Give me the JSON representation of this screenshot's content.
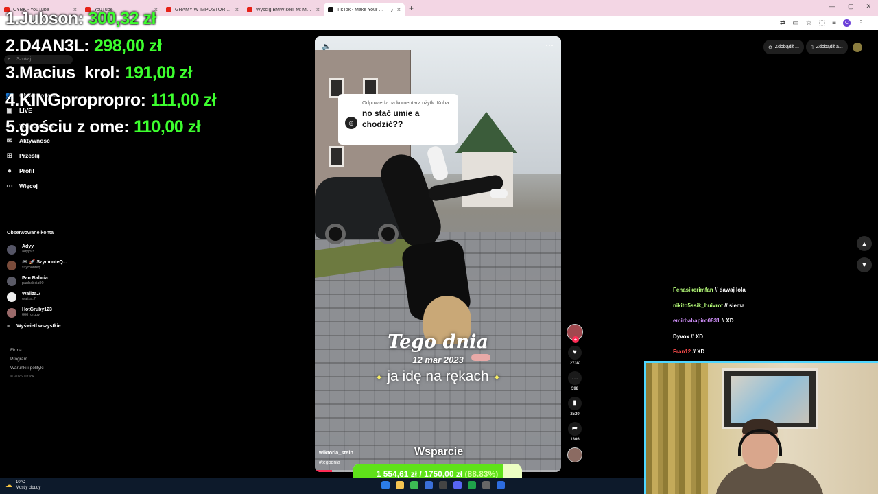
{
  "browser": {
    "tabs": [
      {
        "label": "CYBK - YouTube",
        "active": false
      },
      {
        "label": "YouTube",
        "active": false
      },
      {
        "label": "GRAMY W IMPOSTORA *INTEL",
        "active": false
      },
      {
        "label": "Wyścig BMW serii M: M2, M3, M",
        "active": false
      },
      {
        "label": "TikTok - Make Your Day",
        "active": true
      }
    ],
    "profile_initial": "C"
  },
  "leaderboard": [
    {
      "rank": "1.",
      "name": "Jubson:",
      "amount": "300,32 zł"
    },
    {
      "rank": "2.",
      "name": "D4AN3L:",
      "amount": "298,00 zł"
    },
    {
      "rank": "3.",
      "name": "Macius_krol:",
      "amount": "191,00 zł"
    },
    {
      "rank": "4.",
      "name": "KINGpropropro:",
      "amount": "111,00 zł"
    },
    {
      "rank": "5.",
      "name": "gościu z ome:",
      "amount": "110,00 zł"
    }
  ],
  "sidebar": {
    "search_placeholder": "Szukaj",
    "nav": [
      {
        "label": "Obserwowani",
        "icon": "people-icon"
      },
      {
        "label": "LIVE",
        "icon": "live-icon"
      },
      {
        "label": "Wiadomości",
        "icon": "messages-icon"
      },
      {
        "label": "Aktywność",
        "icon": "activity-icon"
      },
      {
        "label": "Prześlij",
        "icon": "upload-icon"
      },
      {
        "label": "Profil",
        "icon": "profile-icon"
      },
      {
        "label": "Więcej",
        "icon": "more-icon"
      }
    ],
    "following_header": "Obserwowane konta",
    "following": [
      {
        "name": "Adyy",
        "handle": "adyy93"
      },
      {
        "name": "🎮 🚀 SzymonteQ...",
        "handle": "szymonteq"
      },
      {
        "name": "Pan Babcia",
        "handle": "panbabcia90"
      },
      {
        "name": "Waliza.7",
        "handle": "waliza.7"
      },
      {
        "name": "HotGruby123",
        "handle": "666_gruby"
      }
    ],
    "show_all": "Wyświetl wszystkie",
    "footer_links": [
      "Firma",
      "Program",
      "Warunki i polityki"
    ],
    "copyright": "© 2026 TikTok"
  },
  "top_right": {
    "btn1": "Zdobądź ...",
    "btn2": "Zdobądź a..."
  },
  "video": {
    "reply_header": "Odpowiedz na komentarz użytk. Kuba",
    "reply_text": "no stać umie a chodzić??",
    "title": "Tego dnia",
    "date": "12 mar 2023",
    "subtitle": "ja idę na rękach",
    "author": "wiktoria_stein",
    "hashtag": "#tegodnia",
    "progress": 0.07
  },
  "rail": {
    "likes": "273K",
    "comments": "598",
    "saves": "2520",
    "shares": "1306"
  },
  "chat": [
    {
      "user": "Fenasikerimfan",
      "sep": " // ",
      "text": "dawaj lola",
      "color": "#b8ff7a"
    },
    {
      "user": "nikito5ssik_huivrot",
      "sep": " // ",
      "text": "siema",
      "color": "#b8ff7a"
    },
    {
      "user": "emirbabapiro0831",
      "sep": " // ",
      "text": "XD",
      "color": "#d493ff"
    },
    {
      "user": "Dyvox",
      "sep": " // ",
      "text": "XD",
      "color": "#ffffff"
    },
    {
      "user": "Fran12",
      "sep": " // ",
      "text": "XD",
      "color": "#ff4d4d"
    }
  ],
  "support": {
    "label": "Wsparcie",
    "current": "1 554,61 zł",
    "sep": " / ",
    "goal": "1750,00 zł",
    "percent_text": "(88.83%)",
    "fraction": 0.8883
  },
  "taskbar": {
    "temp": "10°C",
    "weather": "Mostly cloudy"
  },
  "colors": {
    "leaderboard_amount": "#3dff2e",
    "webcam_border": "#4fd6ff",
    "goal_fill": "#5fe21a",
    "tiktok_red": "#fe2c55"
  }
}
